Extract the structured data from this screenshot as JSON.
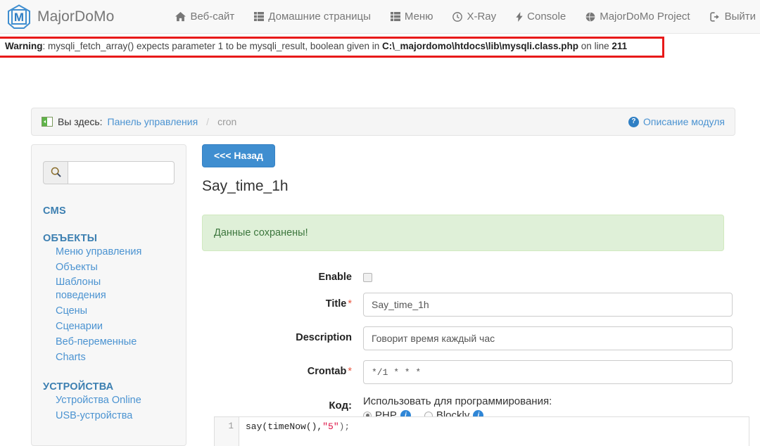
{
  "navbar": {
    "brand": "MajorDoMo",
    "logo_icon": "majordomo-house-m-logo",
    "items": [
      {
        "label": "Веб-сайт",
        "icon": "home-icon"
      },
      {
        "label": "Домашние страницы",
        "icon": "list-icon"
      },
      {
        "label": "Меню",
        "icon": "list-icon"
      },
      {
        "label": "X-Ray",
        "icon": "clock-icon"
      },
      {
        "label": "Console",
        "icon": "bolt-icon"
      },
      {
        "label": "MajorDoMo Project",
        "icon": "globe-icon"
      },
      {
        "label": "Выйти",
        "icon": "sign-out-icon"
      }
    ]
  },
  "warning": {
    "prefix": "Warning",
    "message_1": ": mysqli_fetch_array() expects parameter 1 to be mysqli_result, boolean given in ",
    "file": "C:\\_majordomo\\htdocs\\lib\\mysqli.class.php",
    "message_2": " on line ",
    "line": "211",
    "border_color": "#e81919"
  },
  "breadcrumb": {
    "icon": "page-icon",
    "prefix": "Вы здесь:",
    "root": "Панель управления",
    "separator": "/",
    "current": "cron",
    "help_link": "Описание модуля",
    "help_icon": "question-circle-icon"
  },
  "sidebar": {
    "search": {
      "value": "",
      "placeholder": "",
      "icon": "search-icon"
    },
    "sections": [
      {
        "title": "CMS",
        "links": []
      },
      {
        "title": "ОБЪЕКТЫ",
        "links": [
          "Меню управления",
          "Объекты",
          "Шаблоны поведения",
          "Сцены",
          "Сценарии",
          "Веб-переменные",
          "Charts"
        ]
      },
      {
        "title": "УСТРОЙСТВА",
        "links": [
          "Устройства Online",
          "USB-устройства"
        ]
      }
    ]
  },
  "main": {
    "back_button": "<<< Назад",
    "page_title": "Say_time_1h",
    "alert": "Данные сохранены!",
    "form": {
      "enable": {
        "label": "Enable",
        "checked": false
      },
      "title": {
        "label": "Title",
        "required": true,
        "value": "Say_time_1h"
      },
      "description": {
        "label": "Description",
        "required": false,
        "value": "Говорит время каждый час"
      },
      "crontab": {
        "label": "Crontab",
        "required": true,
        "value": "*/1 * * *"
      },
      "code": {
        "label": "Код:",
        "prompt": "Использовать для программирования:",
        "options": [
          {
            "label": "PHP",
            "selected": true,
            "info_icon": "info-circle-icon"
          },
          {
            "label": "Blockly",
            "selected": false,
            "info_icon": "info-circle-icon"
          }
        ]
      }
    },
    "editor": {
      "lines": [
        {
          "number": "1",
          "fn": "say(timeNow(),",
          "str": "\"5\"",
          "tail": ");"
        }
      ]
    }
  },
  "colors": {
    "brand_blue": "#3f8ed0",
    "link_blue": "#4b93d1",
    "warning_red": "#e81919",
    "success_green": "#dff0d8"
  }
}
